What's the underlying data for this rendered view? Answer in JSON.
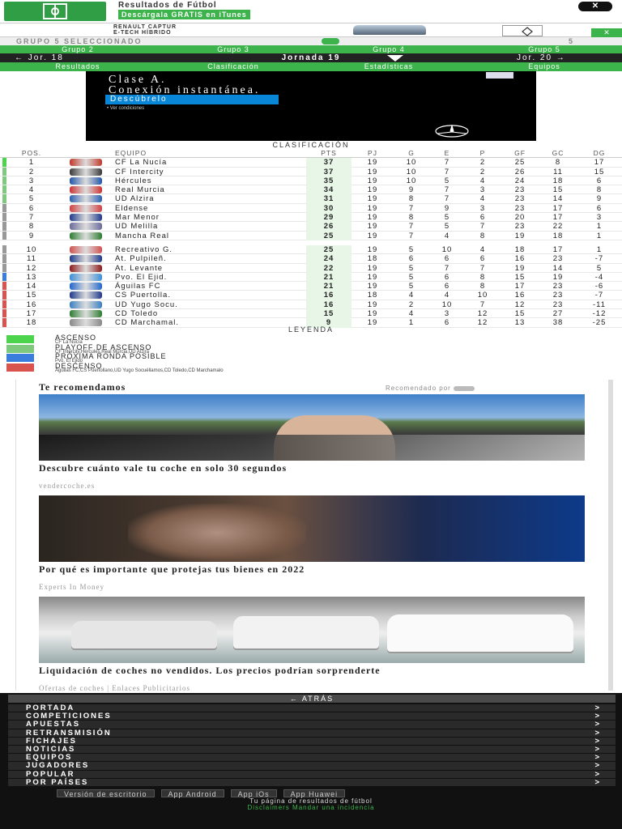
{
  "banner": {
    "title": "Resultados de Fútbol",
    "cta": "Descárgala GRATIS en iTunes",
    "close_label": "✕"
  },
  "ad_strip": {
    "brand_line1": "RENAULT CAPTUR",
    "brand_line2": "E-TECH HÍBRIDO",
    "close_label": "✕"
  },
  "group_bar": {
    "selected_label": "GRUPO 5 SELECCIONADO",
    "count": "5"
  },
  "group_tabs": [
    "Grupo 2",
    "Grupo 3",
    "Grupo 4",
    "Grupo 5"
  ],
  "round": {
    "prev": "← Jor. 18",
    "current": "Jornada 19",
    "next": "Jor. 20 →"
  },
  "section_tabs": [
    "Resultados",
    "Clasificación",
    "Estadísticas",
    "Equipos"
  ],
  "ad_main": {
    "title_line1": "Clase A.",
    "title_line2": "Conexión instantánea.",
    "cta": "Descúbrelo",
    "terms": "• Ver condiciones"
  },
  "standings": {
    "title": "CLASIFICACIÓN",
    "headers": {
      "pos": "POS.",
      "team": "EQUIPO",
      "pts": "PTS",
      "pj": "PJ",
      "g": "G",
      "e": "E",
      "p": "P",
      "gf": "GF",
      "gc": "GC",
      "dg": "DG"
    },
    "rows": [
      {
        "pos": "1",
        "team": "CF La Nucía",
        "pts": "37",
        "pj": "19",
        "g": "10",
        "e": "7",
        "p": "2",
        "gf": "25",
        "gc": "8",
        "dg": "17",
        "zone": "#4cd44c",
        "badge": "#c0392b"
      },
      {
        "pos": "2",
        "team": "CF Intercity",
        "pts": "37",
        "pj": "19",
        "g": "10",
        "e": "7",
        "p": "2",
        "gf": "26",
        "gc": "11",
        "dg": "15",
        "zone": "#7fc97f",
        "badge": "#3a3a3a"
      },
      {
        "pos": "3",
        "team": "Hércules",
        "pts": "35",
        "pj": "19",
        "g": "10",
        "e": "5",
        "p": "4",
        "gf": "24",
        "gc": "18",
        "dg": "6",
        "zone": "#7fc97f",
        "badge": "#2255aa"
      },
      {
        "pos": "4",
        "team": "Real Murcia",
        "pts": "34",
        "pj": "19",
        "g": "9",
        "e": "7",
        "p": "3",
        "gf": "23",
        "gc": "15",
        "dg": "8",
        "zone": "#7fc97f",
        "badge": "#cc3333"
      },
      {
        "pos": "5",
        "team": "UD Alzira",
        "pts": "31",
        "pj": "19",
        "g": "8",
        "e": "7",
        "p": "4",
        "gf": "23",
        "gc": "14",
        "dg": "9",
        "zone": "#7fc97f",
        "badge": "#2a5fb0"
      },
      {
        "pos": "6",
        "team": "Eldense",
        "pts": "30",
        "pj": "19",
        "g": "7",
        "e": "9",
        "p": "3",
        "gf": "23",
        "gc": "17",
        "dg": "6",
        "zone": "#999999",
        "badge": "#d04040"
      },
      {
        "pos": "7",
        "team": "Mar Menor",
        "pts": "29",
        "pj": "19",
        "g": "8",
        "e": "5",
        "p": "6",
        "gf": "20",
        "gc": "17",
        "dg": "3",
        "zone": "#999999",
        "badge": "#1e3a8a"
      },
      {
        "pos": "8",
        "team": "UD Melilla",
        "pts": "26",
        "pj": "19",
        "g": "7",
        "e": "5",
        "p": "7",
        "gf": "23",
        "gc": "22",
        "dg": "1",
        "zone": "#999999",
        "badge": "#6a6a9a"
      },
      {
        "pos": "9",
        "team": "Mancha Real",
        "pts": "25",
        "pj": "19",
        "g": "7",
        "e": "4",
        "p": "8",
        "gf": "19",
        "gc": "18",
        "dg": "1",
        "zone": "#999999",
        "badge": "#2e7d32"
      },
      {
        "pos": "10",
        "team": "Recreativo G.",
        "pts": "25",
        "pj": "19",
        "g": "5",
        "e": "10",
        "p": "4",
        "gf": "18",
        "gc": "17",
        "dg": "1",
        "zone": "#999999",
        "badge": "#d05050"
      },
      {
        "pos": "11",
        "team": "At. Pulpileñ.",
        "pts": "24",
        "pj": "18",
        "g": "6",
        "e": "6",
        "p": "6",
        "gf": "16",
        "gc": "23",
        "dg": "-7",
        "zone": "#999999",
        "badge": "#1e3a8a"
      },
      {
        "pos": "12",
        "team": "At. Levante",
        "pts": "22",
        "pj": "19",
        "g": "5",
        "e": "7",
        "p": "7",
        "gf": "19",
        "gc": "14",
        "dg": "5",
        "zone": "#999999",
        "badge": "#8b1a1a"
      },
      {
        "pos": "13",
        "team": "Pvo. El Ejid.",
        "pts": "21",
        "pj": "19",
        "g": "5",
        "e": "6",
        "p": "8",
        "gf": "15",
        "gc": "19",
        "dg": "-4",
        "zone": "#3b7ddd",
        "badge": "#3a8ed8"
      },
      {
        "pos": "14",
        "team": "Águilas FC",
        "pts": "21",
        "pj": "19",
        "g": "5",
        "e": "6",
        "p": "8",
        "gf": "17",
        "gc": "23",
        "dg": "-6",
        "zone": "#d9534f",
        "badge": "#2266cc"
      },
      {
        "pos": "15",
        "team": "CS Puertolla.",
        "pts": "16",
        "pj": "18",
        "g": "4",
        "e": "4",
        "p": "10",
        "gf": "16",
        "gc": "23",
        "dg": "-7",
        "zone": "#d9534f",
        "badge": "#1e3a8a"
      },
      {
        "pos": "16",
        "team": "UD Yugo Socu.",
        "pts": "16",
        "pj": "19",
        "g": "2",
        "e": "10",
        "p": "7",
        "gf": "12",
        "gc": "23",
        "dg": "-11",
        "zone": "#d9534f",
        "badge": "#3a7fc0"
      },
      {
        "pos": "17",
        "team": "CD Toledo",
        "pts": "15",
        "pj": "19",
        "g": "4",
        "e": "3",
        "p": "12",
        "gf": "15",
        "gc": "27",
        "dg": "-12",
        "zone": "#d9534f",
        "badge": "#2e7d32"
      },
      {
        "pos": "18",
        "team": "CD Marchamal.",
        "pts": "9",
        "pj": "19",
        "g": "1",
        "e": "6",
        "p": "12",
        "gf": "13",
        "gc": "38",
        "dg": "-25",
        "zone": "#d9534f",
        "badge": "#888888"
      }
    ]
  },
  "legend": {
    "title": "LEYENDA",
    "items": [
      {
        "label": "ASCENSO",
        "teams": "CF La Nucía",
        "color": "#4cd44c"
      },
      {
        "label": "PLAYOFF DE ASCENSO",
        "teams": "CF Intercity,Hércules,Real Murcia,UD Alzira",
        "color": "#7fc97f"
      },
      {
        "label": "PRÓXIMA RONDA POSIBLE",
        "teams": "Pvo. El Ejido",
        "color": "#3b7ddd"
      },
      {
        "label": "DESCENSO",
        "teams": "Águilas FC,CS Puertollano,UD Yugo Socuéllamos,CD Toledo,CD Marchamalo",
        "color": "#d9534f"
      }
    ]
  },
  "recs": {
    "title": "Te recomendamos",
    "by": "Recomendado por",
    "items": [
      {
        "title": "Descubre cuánto vale tu coche en solo 30 segundos",
        "source": "vendercoche.es"
      },
      {
        "title": "Por qué es importante que protejas tus bienes en 2022",
        "source": "Experts In Money"
      },
      {
        "title": "Liquidación de coches no vendidos. Los precios podrían sorprenderte",
        "source": "Ofertas de coches | Enlaces Publicitarios"
      }
    ]
  },
  "footer": {
    "back": "← ATRÁS",
    "menu": [
      "PORTADA",
      "COMPETICIONES",
      "APUESTAS",
      "RETRANSMISIÓN",
      "FICHAJES",
      "NOTICIAS",
      "EQUIPOS",
      "JUGADORES",
      "POPULAR",
      "POR PAÍSES"
    ],
    "arrow": ">",
    "apps": [
      "Versión de escritorio",
      "App Android",
      "App iOs",
      "App Huawei"
    ],
    "tagline": "Tu página de resultados de fútbol",
    "links": "Disclaimers   Mandar una incidencia"
  },
  "colors": {
    "brand_green": "#3cb44b",
    "dark": "#222222"
  }
}
